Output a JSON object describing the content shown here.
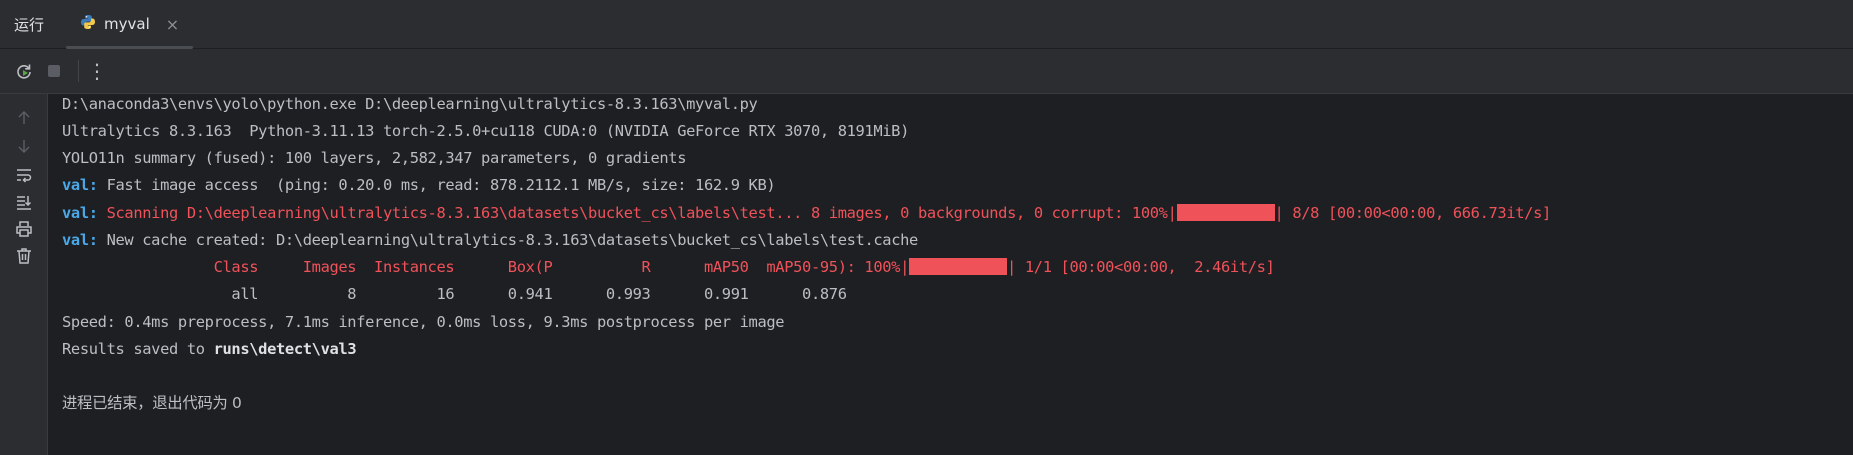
{
  "tabbar": {
    "run_label": "运行",
    "tab_name": "myval",
    "close": "×"
  },
  "icons": {
    "tab": "python-icon",
    "rerun": "rerun-icon",
    "stop": "stop-icon",
    "more": "more-vertical-icon",
    "up": "arrow-up-icon",
    "down": "arrow-down-icon",
    "wrap": "soft-wrap-icon",
    "scroll": "scroll-to-end-icon",
    "print": "print-icon",
    "trash": "trash-icon"
  },
  "toolbar": {
    "more": "⋮"
  },
  "colors": {
    "accent_blue": "#4aa8e8",
    "error_red": "#f0525a",
    "background": "#1e1f22"
  },
  "console": {
    "line1": "D:\\anaconda3\\envs\\yolo\\python.exe D:\\deeplearning\\ultralytics-8.3.163\\myval.py",
    "line2": "Ultralytics 8.3.163  Python-3.11.13 torch-2.5.0+cu118 CUDA:0 (NVIDIA GeForce RTX 3070, 8191MiB)",
    "line3": "YOLO11n summary (fused): 100 layers, 2,582,347 parameters, 0 gradients",
    "line4_prefix": "val:",
    "line4_text": " Fast image access  (ping: 0.20.0 ms, read: 878.2112.1 MB/s, size: 162.9 KB)",
    "line5_prefix": "val:",
    "line5_text": " Scanning D:\\deeplearning\\ultralytics-8.3.163\\datasets\\bucket_cs\\labels\\test... 8 images, 0 backgrounds, 0 corrupt: 100%|",
    "line5_suffix": "| 8/8 [00:00<00:00, 666.73it/s]",
    "line6_prefix": "val:",
    "line6_text": " New cache created: D:\\deeplearning\\ultralytics-8.3.163\\datasets\\bucket_cs\\labels\\test.cache",
    "line7_text": "                 Class     Images  Instances      Box(P          R      mAP50  mAP50-95): 100%|",
    "line7_suffix": "| 1/1 [00:00<00:00,  2.46it/s]",
    "line8": "                   all          8         16      0.941      0.993      0.991      0.876",
    "line9": "Speed: 0.4ms preprocess, 7.1ms inference, 0.0ms loss, 9.3ms postprocess per image",
    "line10_prefix": "Results saved to ",
    "line10_path": "runs\\detect\\val3",
    "line11": "进程已结束，退出代码为 0"
  }
}
